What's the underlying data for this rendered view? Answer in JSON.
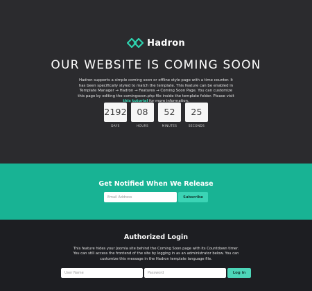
{
  "brand": {
    "name": "Hadron",
    "accent": "#2ed3af",
    "logo_icon": "linked-diamonds-icon"
  },
  "hero": {
    "title": "OUR WEBSITE IS COMING SOON",
    "desc_text": "Hadron supports a simple coming soon or offline style page with a time counter. It has been specifically styled to match the template. This feature can be enabled in Template Manager → Hadron → Features → Coming Soon Page. You can customize this page by editing the comingsoon.php file inside the template folder. Please visit ",
    "desc_link": "this tutorial",
    "desc_after": " for more information."
  },
  "countdown": [
    {
      "value": "2192",
      "label": "DAYS"
    },
    {
      "value": "08",
      "label": "HOURS"
    },
    {
      "value": "52",
      "label": "MINUTES"
    },
    {
      "value": "25",
      "label": "SECONDS"
    }
  ],
  "notify": {
    "title": "Get Notified When We Release",
    "email_placeholder": "Email Address",
    "subscribe_label": "Subscribe",
    "background": "#18b394"
  },
  "login": {
    "title": "Authorized Login",
    "desc": "This feature hides your Joomla site behind the Coming Soon page with its Countdown timer. You can still access the frontend of the site by logging in as an administrator below. You can customize this message in the Hadron template language file.",
    "username_placeholder": "User Name",
    "password_placeholder": "Password",
    "button_label": "Log in"
  }
}
